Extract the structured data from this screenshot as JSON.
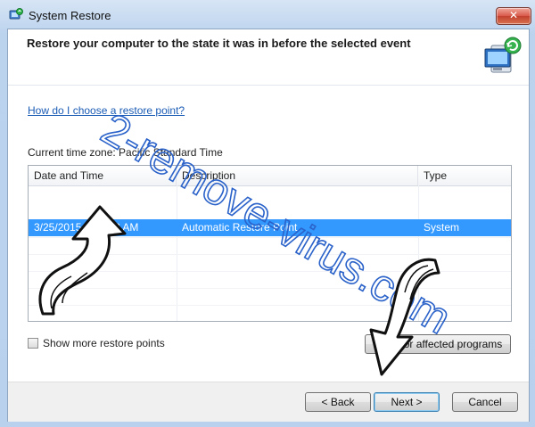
{
  "window": {
    "title": "System Restore",
    "close_label": "✕"
  },
  "header": {
    "heading": "Restore your computer to the state it was in before the selected event"
  },
  "help_link": "How do I choose a restore point?",
  "timezone_label": "Current time zone: Pacific Standard Time",
  "table": {
    "columns": [
      "Date and Time",
      "Description",
      "Type"
    ],
    "rows": [
      {
        "date": "3/25/2015 1:30:33 AM",
        "description": "Automatic Restore Point",
        "type": "System"
      }
    ]
  },
  "show_more_label": "Show more restore points",
  "scan_button": "Scan for affected programs",
  "buttons": {
    "back": "< Back",
    "next": "Next >",
    "cancel": "Cancel"
  },
  "watermark": "2-remove-virus.com",
  "colors": {
    "selection": "#3399ff",
    "watermark": "#2a62c9",
    "link": "#1a5bb5"
  }
}
